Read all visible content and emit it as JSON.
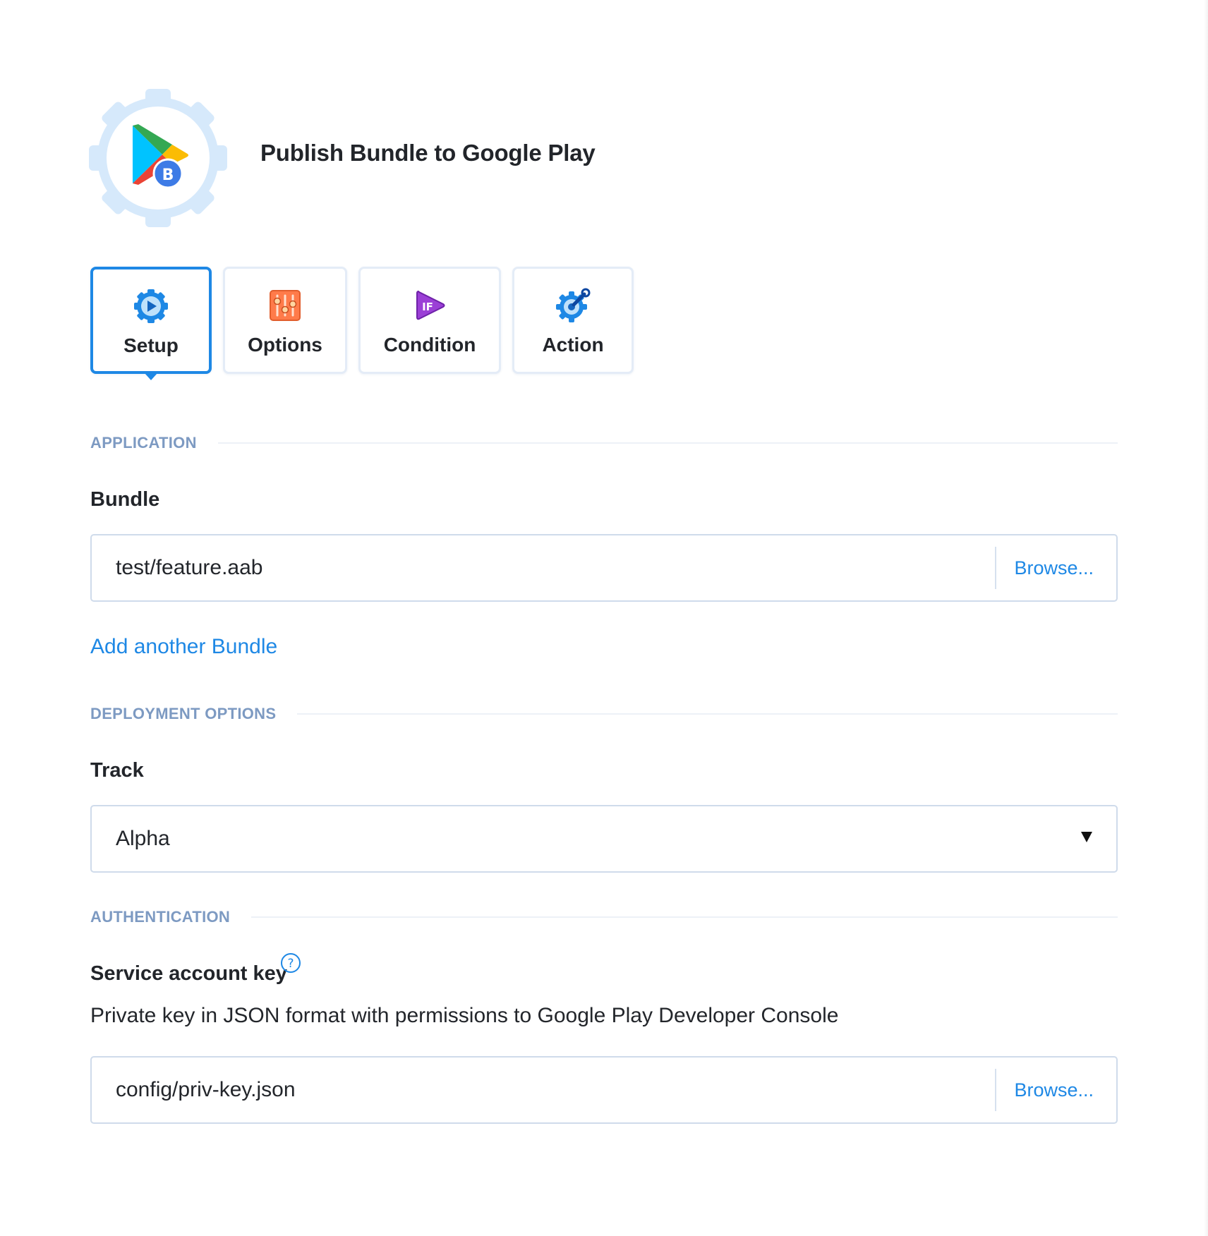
{
  "header": {
    "title": "Publish Bundle to Google Play",
    "logo_icon": "google-play-bundle-gear-icon",
    "logo_badge": "B"
  },
  "tabs": [
    {
      "label": "Setup",
      "icon": "gear-play-icon",
      "active": true
    },
    {
      "label": "Options",
      "icon": "sliders-icon",
      "active": false
    },
    {
      "label": "Condition",
      "icon": "if-play-icon",
      "active": false
    },
    {
      "label": "Action",
      "icon": "gear-wrench-icon",
      "active": false
    }
  ],
  "sections": {
    "application": {
      "heading": "APPLICATION",
      "bundle_label": "Bundle",
      "bundle_value": "test/feature.aab",
      "browse_label": "Browse...",
      "add_link": "Add another Bundle"
    },
    "deployment": {
      "heading": "DEPLOYMENT OPTIONS",
      "track_label": "Track",
      "track_value": "Alpha"
    },
    "authentication": {
      "heading": "AUTHENTICATION",
      "key_label": "Service account key",
      "key_description": "Private key in JSON format with permissions to Google Play Developer Console",
      "key_value": "config/priv-key.json",
      "browse_label": "Browse...",
      "help_icon": "question-circle-icon"
    }
  },
  "colors": {
    "accent": "#1e88e5",
    "section_heading": "#7d9ac2",
    "input_border": "#cfdbeb",
    "text": "#22252a"
  }
}
